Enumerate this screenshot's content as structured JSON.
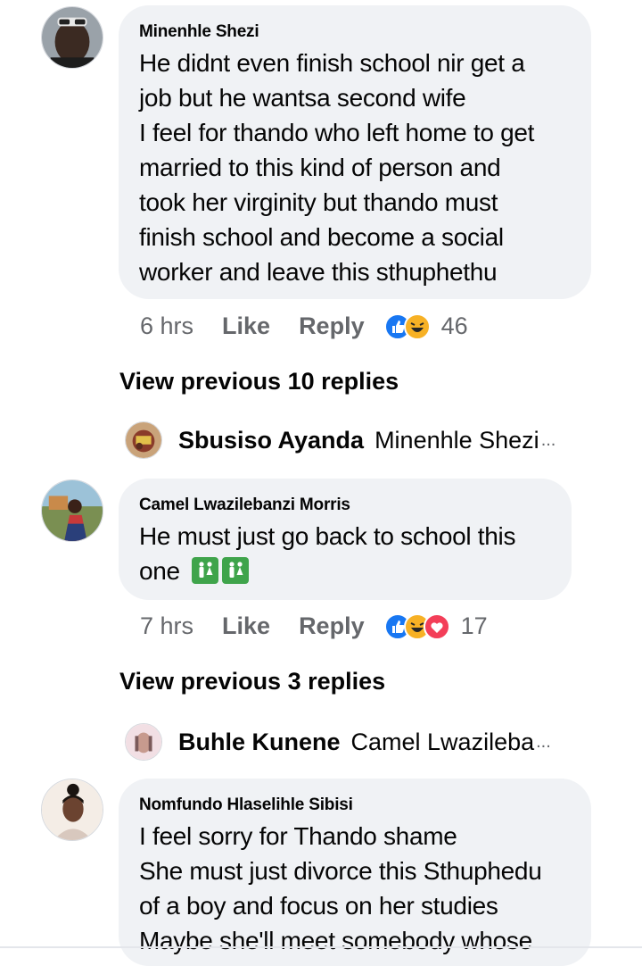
{
  "comments": [
    {
      "author": "Minenhle Shezi",
      "lines": [
        "He didnt even finish school nir get a",
        "job but he wantsa second wife",
        "I feel for thando who left home to get",
        "married to this kind of person and",
        "took her virginity  but thando must",
        "finish school and become a social",
        "worker and leave this sthuphethu"
      ],
      "time": "6 hrs",
      "like_label": "Like",
      "reply_label": "Reply",
      "reaction_count": "46",
      "view_previous": "View previous 10 replies",
      "latest_reply": {
        "author": "Sbusiso Ayanda",
        "snippet": "Minenhle Shezi",
        "ellipsis": "..."
      }
    },
    {
      "author": "Camel Lwazilebanzi Morris",
      "lines": [
        "He must just go back to school this",
        "one"
      ],
      "time": "7 hrs",
      "like_label": "Like",
      "reply_label": "Reply",
      "reaction_count": "17",
      "view_previous": "View previous 3 replies",
      "latest_reply": {
        "author": "Buhle Kunene",
        "snippet": "Camel Lwazileba",
        "ellipsis": "..."
      }
    },
    {
      "author": "Nomfundo Hlaselihle Sibisi",
      "lines": [
        "I feel sorry for Thando shame",
        "She must just divorce this Sthuphedu",
        "of a boy and focus on her studies",
        "Maybe she'll meet somebody whose"
      ]
    }
  ],
  "colors": {
    "bubble": "#f0f2f5",
    "meta": "#65676b",
    "like_reaction": "#1877f2",
    "haha_reaction": "#f7b125",
    "love_reaction": "#f33e58",
    "emoji_green": "#3fa44b"
  },
  "icons": {
    "reactions_c1": [
      "like-reaction-icon",
      "haha-reaction-icon"
    ],
    "reactions_c2": [
      "like-reaction-icon",
      "haha-reaction-icon",
      "love-reaction-icon"
    ],
    "inline_emoji": "restroom-sign-icon"
  }
}
